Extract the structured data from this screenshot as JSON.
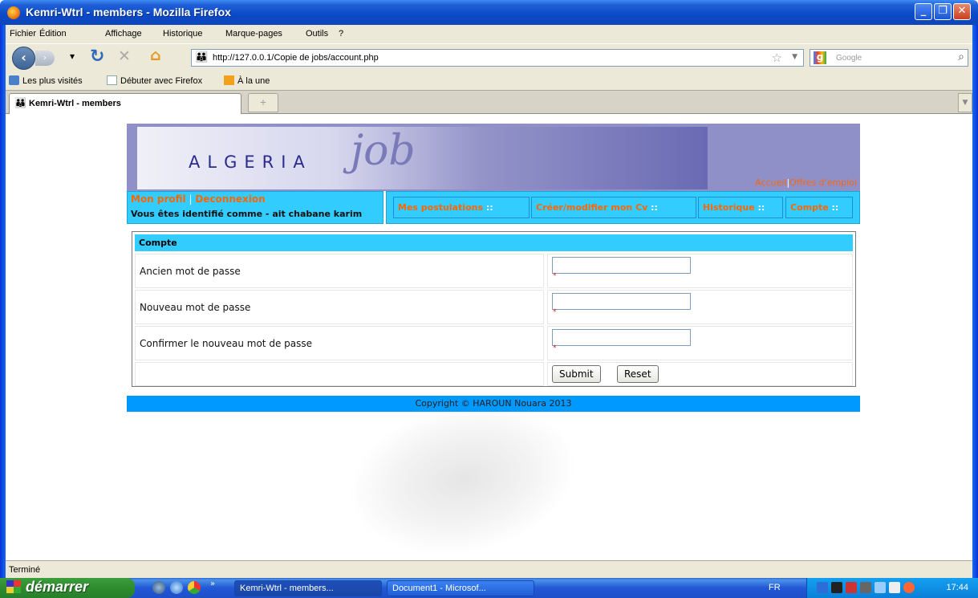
{
  "window": {
    "title": "Kemri-Wtrl - members - Mozilla Firefox",
    "controls": {
      "minimize": "_",
      "maximize": "❐",
      "close": "✕"
    }
  },
  "menu": [
    "Fichier",
    "Édition",
    "Affichage",
    "Historique",
    "Marque-pages",
    "Outils",
    "?"
  ],
  "nav": {
    "url": "http://127.0.0.1/Copie de jobs/account.php",
    "search_placeholder": "Google"
  },
  "bookmarks": [
    "Les plus visités",
    "Débuter avec Firefox",
    "À la une"
  ],
  "tab": {
    "label": "Kemri-Wtrl - members",
    "new_tab": "+"
  },
  "page": {
    "logo_word": "ALGERIA",
    "logo_script": "job",
    "top_links": [
      "Accueil",
      "Offres d'emploi"
    ],
    "user_links": [
      "Mon profil",
      "Deconnexion"
    ],
    "identity": "Vous êtes identifié comme - ait chabane karim",
    "main_nav": [
      "Mes postulations",
      "Créer/modifier mon Cv",
      "Historique",
      "Compte"
    ],
    "form": {
      "heading": "Compte",
      "fields": [
        {
          "label": "Ancien mot de passe",
          "value": ""
        },
        {
          "label": "Nouveau mot de passe",
          "value": ""
        },
        {
          "label": "Confirmer le nouveau mot de passe",
          "value": ""
        }
      ],
      "required_mark": "*",
      "submit": "Submit",
      "reset": "Reset"
    },
    "footer": "Copyright © HAROUN Nouara 2013"
  },
  "status": "Terminé",
  "taskbar": {
    "start": "démarrer",
    "tasks": [
      "Kemri-Wtrl - members...",
      "Document1 - Microsof..."
    ],
    "lang": "FR",
    "clock": "17:44"
  },
  "colors": {
    "accent": "#33ccff",
    "link": "#ff6600",
    "footer": "#0099ff",
    "banner": "#9090c8"
  }
}
